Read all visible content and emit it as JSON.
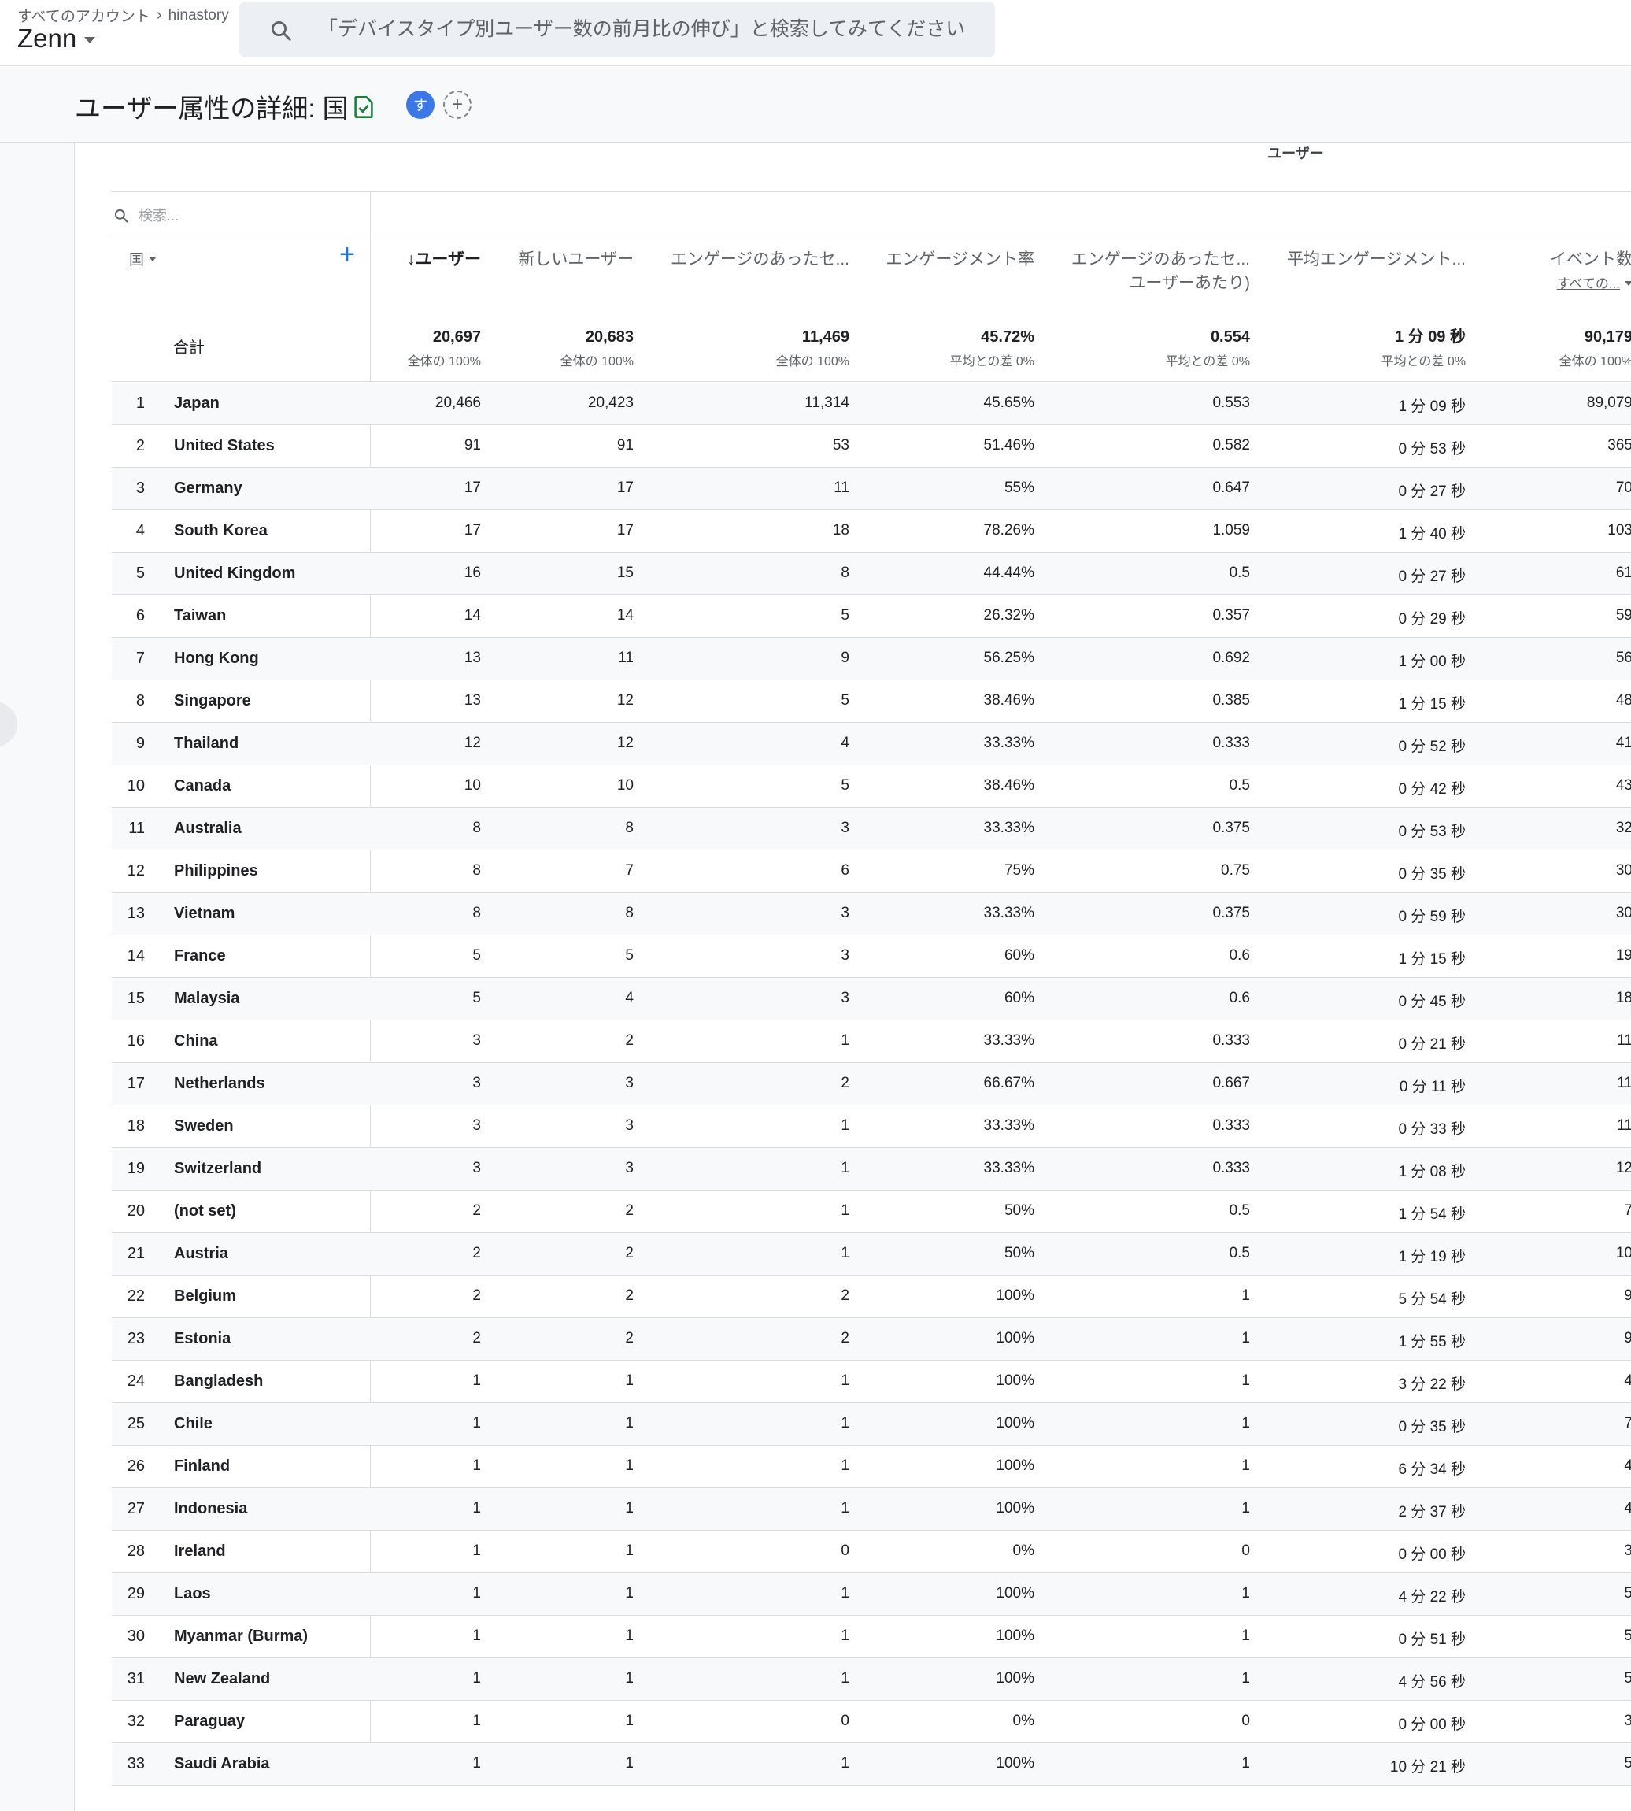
{
  "topbar": {
    "breadcrumb_root": "すべてのアカウント",
    "breadcrumb_account": "hinastory",
    "property_name": "Zenn",
    "search_placeholder": "「デバイスタイプ別ユーザー数の前月比の伸び」と検索してみてください"
  },
  "header": {
    "title": "ユーザー属性の詳細: 国",
    "avatar_letter": "す",
    "add_comparison": "+"
  },
  "report": {
    "group_label": "ユーザー",
    "table_search_placeholder": "検索...",
    "dimension_label": "国",
    "add_dimension": "+",
    "columns": [
      {
        "label": "↓ユーザー"
      },
      {
        "label": "新しいユーザー"
      },
      {
        "label": "エンゲージのあったセ..."
      },
      {
        "label": "エンゲージメント率"
      },
      {
        "label": "エンゲージのあったセ...",
        "sub": "ユーザーあたり)"
      },
      {
        "label": "平均エンゲージメント..."
      },
      {
        "label": "イベント数",
        "sub_link": "すべての..."
      }
    ],
    "totals": {
      "label": "合計",
      "values": [
        {
          "value": "20,697",
          "sub": "全体の 100%"
        },
        {
          "value": "20,683",
          "sub": "全体の 100%"
        },
        {
          "value": "11,469",
          "sub": "全体の 100%"
        },
        {
          "value": "45.72%",
          "sub": "平均との差 0%"
        },
        {
          "value": "0.554",
          "sub": "平均との差 0%"
        },
        {
          "value": "1 分 09 秒",
          "sub": "平均との差 0%"
        },
        {
          "value": "90,179",
          "sub": "全体の 100%"
        }
      ]
    },
    "rows": [
      {
        "rank": "1",
        "country": "Japan",
        "cells": [
          "20,466",
          "20,423",
          "11,314",
          "45.65%",
          "0.553",
          "1 分 09 秒",
          "89,079"
        ]
      },
      {
        "rank": "2",
        "country": "United States",
        "cells": [
          "91",
          "91",
          "53",
          "51.46%",
          "0.582",
          "0 分 53 秒",
          "365"
        ]
      },
      {
        "rank": "3",
        "country": "Germany",
        "cells": [
          "17",
          "17",
          "11",
          "55%",
          "0.647",
          "0 分 27 秒",
          "70"
        ]
      },
      {
        "rank": "4",
        "country": "South Korea",
        "cells": [
          "17",
          "17",
          "18",
          "78.26%",
          "1.059",
          "1 分 40 秒",
          "103"
        ]
      },
      {
        "rank": "5",
        "country": "United Kingdom",
        "cells": [
          "16",
          "15",
          "8",
          "44.44%",
          "0.5",
          "0 分 27 秒",
          "61"
        ]
      },
      {
        "rank": "6",
        "country": "Taiwan",
        "cells": [
          "14",
          "14",
          "5",
          "26.32%",
          "0.357",
          "0 分 29 秒",
          "59"
        ]
      },
      {
        "rank": "7",
        "country": "Hong Kong",
        "cells": [
          "13",
          "11",
          "9",
          "56.25%",
          "0.692",
          "1 分 00 秒",
          "56"
        ]
      },
      {
        "rank": "8",
        "country": "Singapore",
        "cells": [
          "13",
          "12",
          "5",
          "38.46%",
          "0.385",
          "1 分 15 秒",
          "48"
        ]
      },
      {
        "rank": "9",
        "country": "Thailand",
        "cells": [
          "12",
          "12",
          "4",
          "33.33%",
          "0.333",
          "0 分 52 秒",
          "41"
        ]
      },
      {
        "rank": "10",
        "country": "Canada",
        "cells": [
          "10",
          "10",
          "5",
          "38.46%",
          "0.5",
          "0 分 42 秒",
          "43"
        ]
      },
      {
        "rank": "11",
        "country": "Australia",
        "cells": [
          "8",
          "8",
          "3",
          "33.33%",
          "0.375",
          "0 分 53 秒",
          "32"
        ]
      },
      {
        "rank": "12",
        "country": "Philippines",
        "cells": [
          "8",
          "7",
          "6",
          "75%",
          "0.75",
          "0 分 35 秒",
          "30"
        ]
      },
      {
        "rank": "13",
        "country": "Vietnam",
        "cells": [
          "8",
          "8",
          "3",
          "33.33%",
          "0.375",
          "0 分 59 秒",
          "30"
        ]
      },
      {
        "rank": "14",
        "country": "France",
        "cells": [
          "5",
          "5",
          "3",
          "60%",
          "0.6",
          "1 分 15 秒",
          "19"
        ]
      },
      {
        "rank": "15",
        "country": "Malaysia",
        "cells": [
          "5",
          "4",
          "3",
          "60%",
          "0.6",
          "0 分 45 秒",
          "18"
        ]
      },
      {
        "rank": "16",
        "country": "China",
        "cells": [
          "3",
          "2",
          "1",
          "33.33%",
          "0.333",
          "0 分 21 秒",
          "11"
        ]
      },
      {
        "rank": "17",
        "country": "Netherlands",
        "cells": [
          "3",
          "3",
          "2",
          "66.67%",
          "0.667",
          "0 分 11 秒",
          "11"
        ]
      },
      {
        "rank": "18",
        "country": "Sweden",
        "cells": [
          "3",
          "3",
          "1",
          "33.33%",
          "0.333",
          "0 分 33 秒",
          "11"
        ]
      },
      {
        "rank": "19",
        "country": "Switzerland",
        "cells": [
          "3",
          "3",
          "1",
          "33.33%",
          "0.333",
          "1 分 08 秒",
          "12"
        ]
      },
      {
        "rank": "20",
        "country": "(not set)",
        "cells": [
          "2",
          "2",
          "1",
          "50%",
          "0.5",
          "1 分 54 秒",
          "7"
        ]
      },
      {
        "rank": "21",
        "country": "Austria",
        "cells": [
          "2",
          "2",
          "1",
          "50%",
          "0.5",
          "1 分 19 秒",
          "10"
        ]
      },
      {
        "rank": "22",
        "country": "Belgium",
        "cells": [
          "2",
          "2",
          "2",
          "100%",
          "1",
          "5 分 54 秒",
          "9"
        ]
      },
      {
        "rank": "23",
        "country": "Estonia",
        "cells": [
          "2",
          "2",
          "2",
          "100%",
          "1",
          "1 分 55 秒",
          "9"
        ]
      },
      {
        "rank": "24",
        "country": "Bangladesh",
        "cells": [
          "1",
          "1",
          "1",
          "100%",
          "1",
          "3 分 22 秒",
          "4"
        ]
      },
      {
        "rank": "25",
        "country": "Chile",
        "cells": [
          "1",
          "1",
          "1",
          "100%",
          "1",
          "0 分 35 秒",
          "7"
        ]
      },
      {
        "rank": "26",
        "country": "Finland",
        "cells": [
          "1",
          "1",
          "1",
          "100%",
          "1",
          "6 分 34 秒",
          "4"
        ]
      },
      {
        "rank": "27",
        "country": "Indonesia",
        "cells": [
          "1",
          "1",
          "1",
          "100%",
          "1",
          "2 分 37 秒",
          "4"
        ]
      },
      {
        "rank": "28",
        "country": "Ireland",
        "cells": [
          "1",
          "1",
          "0",
          "0%",
          "0",
          "0 分 00 秒",
          "3"
        ]
      },
      {
        "rank": "29",
        "country": "Laos",
        "cells": [
          "1",
          "1",
          "1",
          "100%",
          "1",
          "4 分 22 秒",
          "5"
        ]
      },
      {
        "rank": "30",
        "country": "Myanmar (Burma)",
        "cells": [
          "1",
          "1",
          "1",
          "100%",
          "1",
          "0 分 51 秒",
          "5"
        ]
      },
      {
        "rank": "31",
        "country": "New Zealand",
        "cells": [
          "1",
          "1",
          "1",
          "100%",
          "1",
          "4 分 56 秒",
          "5"
        ]
      },
      {
        "rank": "32",
        "country": "Paraguay",
        "cells": [
          "1",
          "1",
          "0",
          "0%",
          "0",
          "0 分 00 秒",
          "3"
        ]
      },
      {
        "rank": "33",
        "country": "Saudi Arabia",
        "cells": [
          "1",
          "1",
          "1",
          "100%",
          "1",
          "10 分 21 秒",
          "5"
        ]
      }
    ]
  },
  "colors": {
    "accent": "#1a73e8",
    "avatar_bg": "#3b78e7",
    "check_green": "#188038",
    "row_alt_bg": "#f8f9fa",
    "border": "#dadce0"
  },
  "icons": {
    "search": "search-icon",
    "check": "check-document-icon",
    "dimension_caret": "chevron-down-icon",
    "add": "plus-icon"
  }
}
